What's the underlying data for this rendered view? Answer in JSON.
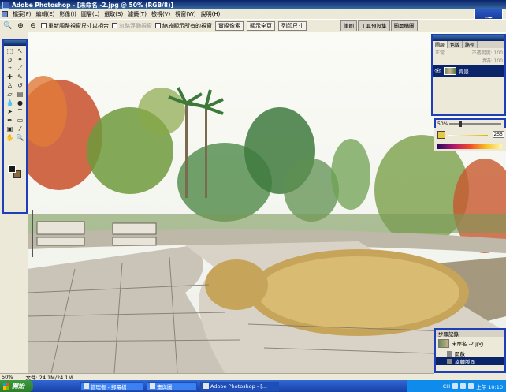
{
  "window": {
    "title": "Adobe Photoshop - [未命名 -2.jpg @ 50% (RGB/8)]"
  },
  "menu": [
    "檔案(F)",
    "編輯(E)",
    "影像(I)",
    "圖層(L)",
    "選取(S)",
    "濾鏡(T)",
    "檢視(V)",
    "視窗(W)",
    "說明(H)"
  ],
  "options": {
    "zoom_icon": "magnifier-icon",
    "resize_windows": "重新調整視窗尺寸以相合",
    "ignore_palettes": "忽略浮動視窗",
    "zoom_all": "縮放顯示所有的視窗",
    "actual_pixels": "實際像素",
    "fit_screen": "顯示全頁",
    "print_size": "列印尺寸"
  },
  "well_tabs": [
    "筆刷",
    "工具預設集",
    "圖層構圖"
  ],
  "layers_panel": {
    "tabs": [
      "圖層",
      "色版",
      "路徑"
    ],
    "blend_mode": "正常",
    "opacity_label": "不透明度: 100",
    "fill_label": "填滿: 100",
    "layer_name": "背景"
  },
  "navigator": {
    "zoom": "50%"
  },
  "color_panel": {
    "value": "255"
  },
  "history_panel": {
    "title": "步驟記錄",
    "snapshot": "未命名 -2.jpg",
    "steps": [
      "開啟",
      "旋轉版面"
    ]
  },
  "status": {
    "zoom": "50%",
    "doc_size": "文件: 24.1M/24.1M"
  },
  "taskbar": {
    "start_label": "開始",
    "tasks": [
      "管理者 - 郵電檔",
      "畫與圖",
      "Adobe Photoshop - [..."
    ],
    "tray_lang": "CH",
    "clock": "上午 10:10"
  },
  "colors": {
    "title_bar": "#0a246a",
    "panel_border": "#1e3fb8",
    "taskbar": "#3168d5",
    "start_button": "#3c9a3c"
  }
}
